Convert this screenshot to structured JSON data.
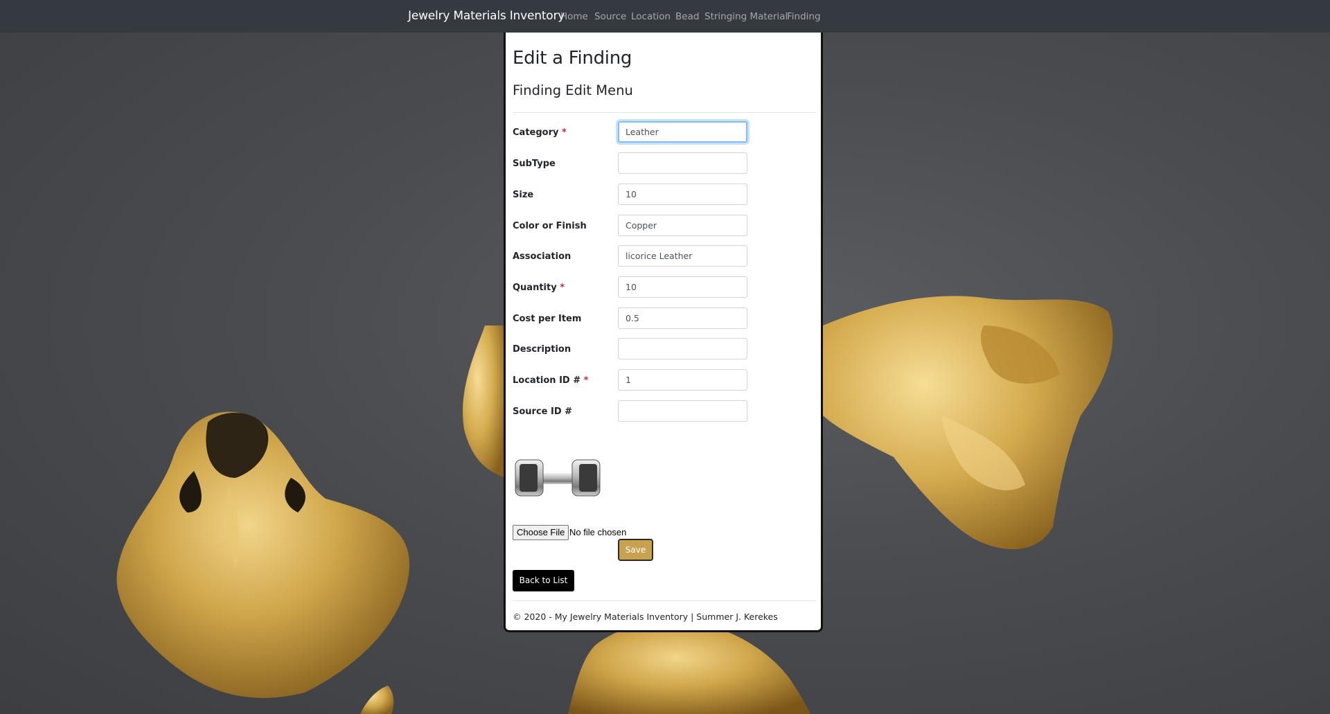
{
  "navbar": {
    "brand": "Jewelry Materials Inventory",
    "links": [
      "Home",
      "Source",
      "Location",
      "Bead",
      "Stringing Material",
      "Finding"
    ]
  },
  "page": {
    "title": "Edit a Finding",
    "subtitle": "Finding Edit Menu"
  },
  "form": {
    "fields": [
      {
        "label": "Category",
        "required": "*",
        "value": "Leather"
      },
      {
        "label": "SubType",
        "required": "",
        "value": ""
      },
      {
        "label": "Size",
        "required": "",
        "value": "10"
      },
      {
        "label": "Color or Finish",
        "required": "",
        "value": "Copper"
      },
      {
        "label": "Association",
        "required": "",
        "value": "licorice Leather"
      },
      {
        "label": "Quantity",
        "required": "*",
        "value": "10"
      },
      {
        "label": "Cost per Item",
        "required": "",
        "value": "0.5"
      },
      {
        "label": "Description",
        "required": "",
        "value": ""
      },
      {
        "label": "Location ID #",
        "required": "*",
        "value": "1"
      },
      {
        "label": "Source ID #",
        "required": "",
        "value": ""
      }
    ],
    "file_button": "Choose File",
    "file_status": "No file chosen",
    "save_label": "Save",
    "back_label": "Back to List"
  },
  "footer": "© 2020 - My Jewelry Materials Inventory | Summer J. Kerekes",
  "colors": {
    "navbar": "#343a40",
    "save_button": "#c9a24f",
    "back_button": "#000000",
    "required_marker": "#c4302b",
    "focus_ring": "#80bdff"
  },
  "icons": {
    "thumbnail": "finding-clasp-image"
  }
}
